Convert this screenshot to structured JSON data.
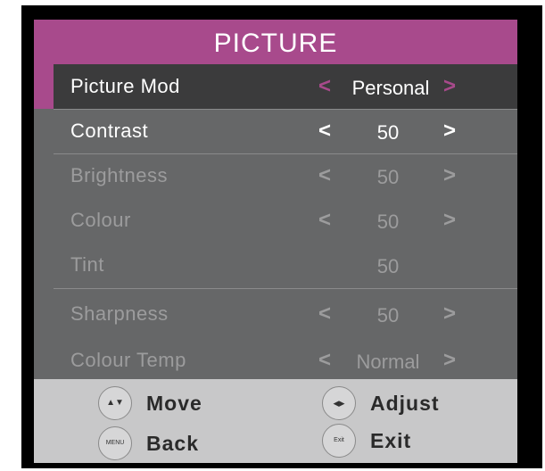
{
  "menu": {
    "title": "PICTURE",
    "rows": [
      {
        "label": "Picture Mod",
        "value": "Personal",
        "left_arrow": "<",
        "right_arrow": ">"
      },
      {
        "label": "Contrast",
        "value": "50",
        "left_arrow": "<",
        "right_arrow": ">"
      },
      {
        "label": "Brightness",
        "value": "50",
        "left_arrow": "<",
        "right_arrow": ">"
      },
      {
        "label": "Colour",
        "value": "50",
        "left_arrow": "<",
        "right_arrow": ">"
      },
      {
        "label": "Tint",
        "value": "50"
      },
      {
        "label": "Sharpness",
        "value": "50",
        "left_arrow": "<",
        "right_arrow": ">"
      },
      {
        "label": "Colour Temp",
        "value": "Normal",
        "left_arrow": "<",
        "right_arrow": ">"
      }
    ]
  },
  "footer": {
    "move_label": "Move",
    "adjust_label": "Adjust",
    "back_label": "Back",
    "exit_label": "Exit",
    "menu_key_text": "MENU",
    "exit_key_text": "Exit",
    "move_icon_glyph": "▲▼",
    "adjust_icon_glyph": "◂▸"
  },
  "colors": {
    "accent": "#a84a8c",
    "panel": "#666768",
    "selected_row": "#3b3b3c",
    "footer": "#c8c8c9"
  }
}
